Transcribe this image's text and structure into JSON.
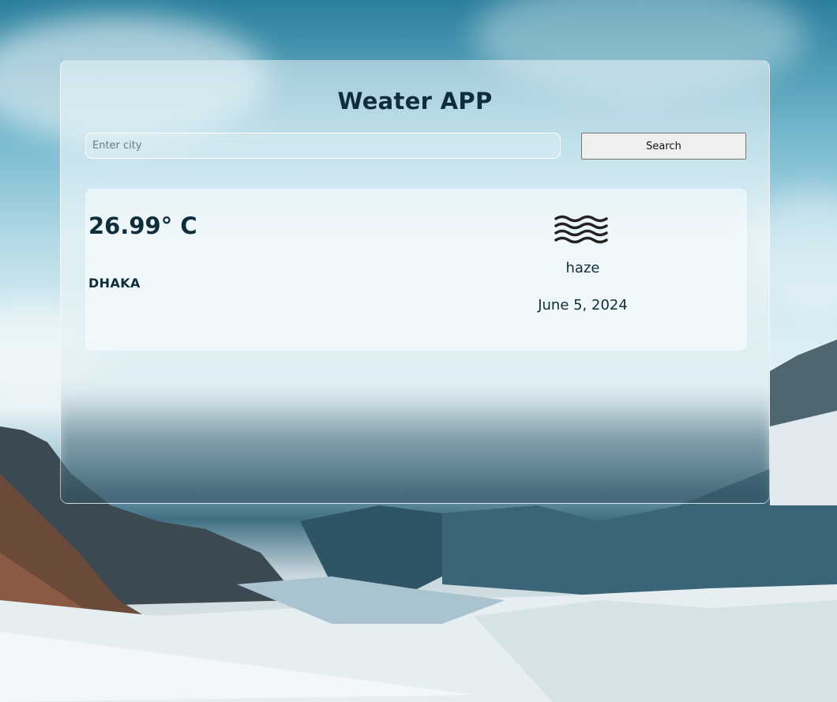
{
  "app": {
    "title": "Weater APP"
  },
  "search": {
    "placeholder": "Enter city",
    "value": "",
    "button_label": "Search"
  },
  "weather": {
    "temperature": "26.99° C",
    "city": "DHAKA",
    "condition_icon": "haze-icon",
    "description": "haze",
    "date": "June 5, 2024"
  },
  "colors": {
    "text": "#0f2d3a",
    "button_bg": "#efefef",
    "button_border": "#767676"
  }
}
